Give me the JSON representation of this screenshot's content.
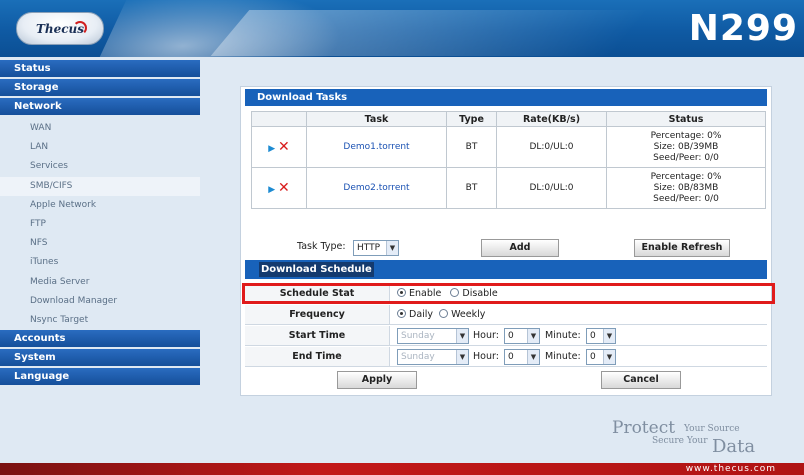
{
  "header": {
    "logo_text": "Thecus",
    "model": "N299"
  },
  "sidebar": {
    "groups": [
      {
        "label": "Status"
      },
      {
        "label": "Storage"
      },
      {
        "label": "Network"
      },
      {
        "label": "Accounts"
      },
      {
        "label": "System"
      },
      {
        "label": "Language"
      }
    ],
    "network_items": [
      "WAN",
      "LAN",
      "Services",
      "SMB/CIFS",
      "Apple Network",
      "FTP",
      "NFS",
      "iTunes",
      "Media Server",
      "Download Manager",
      "Nsync Target"
    ]
  },
  "panel": {
    "title": "Download Tasks",
    "columns": [
      "Task",
      "Type",
      "Rate(KB/s)",
      "Status"
    ],
    "rows": [
      {
        "task": "Demo1.torrent",
        "type": "BT",
        "rate": "DL:0/UL:0",
        "status_1": "Percentage: 0%",
        "status_2": "Size: 0B/39MB",
        "status_3": "Seed/Peer: 0/0"
      },
      {
        "task": "Demo2.torrent",
        "type": "BT",
        "rate": "DL:0/UL:0",
        "status_1": "Percentage: 0%",
        "status_2": "Size: 0B/83MB",
        "status_3": "Seed/Peer: 0/0"
      }
    ],
    "task_type_label": "Task Type:",
    "task_type_value": "HTTP",
    "add_label": "Add",
    "refresh_label": "Enable Refresh"
  },
  "schedule": {
    "title": "Download Schedule",
    "stat_label": "Schedule Stat",
    "enable_label": "Enable",
    "disable_label": "Disable",
    "frequency_label": "Frequency",
    "daily_label": "Daily",
    "weekly_label": "Weekly",
    "start_label": "Start Time",
    "end_label": "End Time",
    "day_value": "Sunday",
    "hour_label": "Hour:",
    "minute_label": "Minute:",
    "hour_value": "0",
    "minute_value": "0",
    "apply_label": "Apply",
    "cancel_label": "Cancel"
  },
  "tagline": {
    "protect": "Protect",
    "your_source": "Your Source",
    "secure_your": "Secure Your",
    "data": "Data"
  },
  "footer": {
    "url": "www.thecus.com"
  },
  "colors": {
    "header_blue": "#0f5aa3",
    "section_blue": "#1862ba",
    "highlight_red": "#e01b1b",
    "footer_red": "#c21818"
  }
}
